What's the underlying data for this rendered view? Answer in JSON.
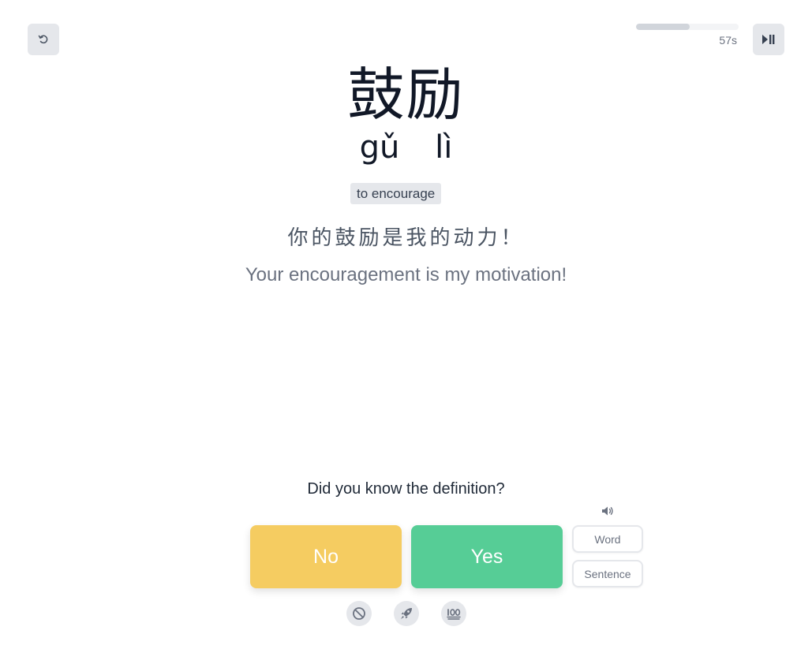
{
  "header": {
    "timer": "57s",
    "progress": 0.52,
    "undo_icon": "undo-icon",
    "playpause_icon": "play-pause-icon"
  },
  "card": {
    "hanzi": "鼓励",
    "pinyin": "gǔ lì",
    "definition": "to encourage",
    "sentence_zh": "你的鼓励是我的动力！",
    "sentence_en": "Your encouragement is my motivation!"
  },
  "quiz": {
    "question": "Did you know the definition?",
    "no_label": "No",
    "yes_label": "Yes"
  },
  "audio": {
    "speaker_icon": "speaker-icon",
    "word_label": "Word",
    "sentence_label": "Sentence"
  },
  "actions": {
    "icons": [
      "ban-icon",
      "rocket-icon",
      "hundred-icon"
    ]
  },
  "colors": {
    "no": "#f5cc61",
    "yes": "#56cd96",
    "icon_bg": "#e5e7eb",
    "progress_fill": "#d1d5db"
  }
}
